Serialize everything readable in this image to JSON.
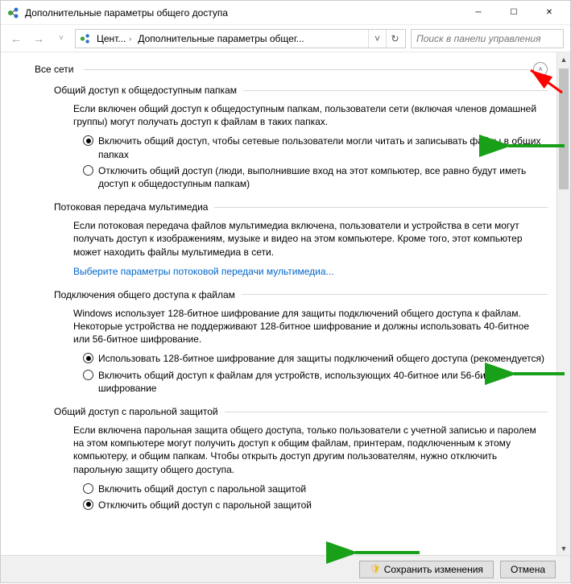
{
  "window": {
    "title": "Дополнительные параметры общего доступа"
  },
  "breadcrumb": {
    "seg1": "Цент...",
    "seg2": "Дополнительные параметры общег..."
  },
  "search": {
    "placeholder": "Поиск в панели управления"
  },
  "top_section": "Все сети",
  "public_folders": {
    "title": "Общий доступ к общедоступным папкам",
    "desc": "Если включен общий доступ к общедоступным папкам, пользователи сети (включая членов домашней группы) могут получать доступ к файлам в таких папках.",
    "opt1": "Включить общий доступ, чтобы сетевые пользователи могли читать и записывать файлы в общих папках",
    "opt2": "Отключить общий доступ (люди, выполнившие вход на этот компьютер, все равно будут иметь доступ к общедоступным папкам)"
  },
  "media": {
    "title": "Потоковая передача мультимедиа",
    "desc": "Если потоковая передача файлов мультимедиа включена, пользователи и устройства в сети могут получать доступ к изображениям, музыке и видео на этом компьютере. Кроме того, этот компьютер может находить файлы мультимедиа в сети.",
    "link": "Выберите параметры потоковой передачи мультимедиа..."
  },
  "encryption": {
    "title": "Подключения общего доступа к файлам",
    "desc": "Windows использует 128-битное шифрование для защиты подключений общего доступа к файлам. Некоторые устройства не поддерживают 128-битное шифрование и должны использовать 40-битное или 56-битное шифрование.",
    "opt1": "Использовать 128-битное шифрование для защиты подключений общего доступа (рекомендуется)",
    "opt2": "Включить общий доступ к файлам для устройств, использующих 40-битное или 56-битное шифрование"
  },
  "password": {
    "title": "Общий доступ с парольной защитой",
    "desc": "Если включена парольная защита общего доступа, только пользователи с учетной записью и паролем на этом компьютере могут получить доступ к общим файлам, принтерам, подключенным к этому компьютеру, и общим папкам. Чтобы открыть доступ другим пользователям, нужно отключить парольную защиту общего доступа.",
    "opt1": "Включить общий доступ с парольной защитой",
    "opt2": "Отключить общий доступ с парольной защитой"
  },
  "buttons": {
    "save": "Сохранить изменения",
    "cancel": "Отмена"
  }
}
